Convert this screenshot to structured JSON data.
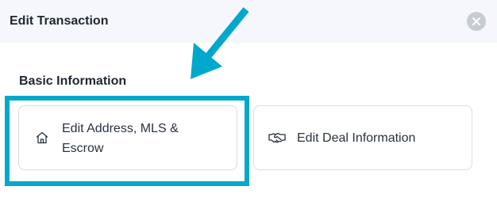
{
  "header": {
    "title": "Edit Transaction",
    "close_icon": "close-icon"
  },
  "section": {
    "title": "Basic Information"
  },
  "cards": [
    {
      "label": "Edit Address, MLS & Escrow",
      "icon": "home-icon"
    },
    {
      "label": "Edit Deal Information",
      "icon": "handshake-icon"
    }
  ],
  "colors": {
    "highlight": "#00a8cc",
    "header_bg": "#f5f7fc",
    "close_bg": "#c8ccd3"
  }
}
